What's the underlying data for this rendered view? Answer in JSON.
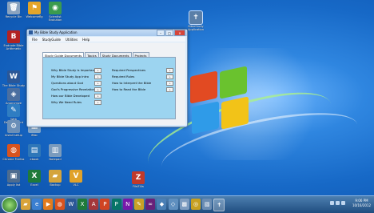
{
  "desktop": {
    "icons": [
      {
        "id": "recycle-bin",
        "label": "Recycle Bin",
        "glyph": "🗑",
        "color": "#8aa3bf"
      },
      {
        "id": "welcomeflag",
        "label": "Welcomeflg",
        "glyph": "⚑",
        "color": "#e3a52a"
      },
      {
        "id": "scientist",
        "label": "Scientist Evolution",
        "glyph": "◉",
        "color": "#3b9b4e"
      },
      {
        "id": "bible-study-app",
        "label": "BibleStudy Application",
        "glyph": "✝",
        "color": "#5a7fa8"
      },
      {
        "id": "endnote",
        "label": "Endnote Bible Arithmetic",
        "glyph": "B",
        "color": "#b22222"
      },
      {
        "id": "word-doc-1",
        "label": "The Bible Study",
        "glyph": "W",
        "color": "#2b5797"
      },
      {
        "id": "app-icon",
        "label": "Anonymize",
        "glyph": "◈",
        "color": "#4b6fa0"
      },
      {
        "id": "tool-icon",
        "label": "Web Development",
        "glyph": "✎",
        "color": "#2f7dc2"
      },
      {
        "id": "setup-icon",
        "label": "install setup",
        "glyph": "⚙",
        "color": "#6a8fb8"
      },
      {
        "id": "chart-icon",
        "label": "iMac",
        "glyph": "▦",
        "color": "#7fa4c9"
      },
      {
        "id": "firefox",
        "label": "Chrome Firefox",
        "glyph": "◍",
        "color": "#d9531e"
      },
      {
        "id": "ebook",
        "label": "ebook",
        "glyph": "▤",
        "color": "#2f77b8"
      },
      {
        "id": "notepad",
        "label": "Notepad",
        "glyph": "▥",
        "color": "#7a9bbd"
      },
      {
        "id": "doc-icon",
        "label": "Apply list",
        "glyph": "▣",
        "color": "#4d6c8f"
      },
      {
        "id": "excel",
        "label": "Excel",
        "glyph": "X",
        "color": "#1f7a3a"
      },
      {
        "id": "folder",
        "label": "Backup",
        "glyph": "▰",
        "color": "#d4a43c"
      },
      {
        "id": "vlc",
        "label": "VLC",
        "glyph": "V",
        "color": "#e0a22a"
      },
      {
        "id": "filezilla",
        "label": "FileZilla",
        "glyph": "Z",
        "color": "#c0392b"
      }
    ]
  },
  "window": {
    "title": "My Bible Study Application",
    "min": "–",
    "max": "□",
    "close": "✕",
    "menu": [
      "File",
      "StudyGuide",
      "Utilities",
      "Help"
    ],
    "tabs": [
      "Study Guide Documents",
      "Topics",
      "Study Documents",
      "Projects"
    ],
    "left_items": [
      "Why Bible Study is Important",
      "My Bible Study App Intro",
      "Questions about God",
      "God's Progressive Revelation",
      "How our Bible Developed",
      "Why We Need Rules"
    ],
    "right_items": [
      "Required Perspectives",
      "Required Rules",
      "How to Interpret the Bible",
      "How to Read the Bible"
    ],
    "go_label": "»"
  },
  "taskbar": {
    "apps": [
      {
        "name": "explorer",
        "glyph": "▰",
        "color": "#d8a33a"
      },
      {
        "name": "ie",
        "glyph": "e",
        "color": "#3a7fd1"
      },
      {
        "name": "media",
        "glyph": "▶",
        "color": "#e27b1d"
      },
      {
        "name": "firefox",
        "glyph": "◍",
        "color": "#d9531e"
      },
      {
        "name": "word",
        "glyph": "W",
        "color": "#2b5797"
      },
      {
        "name": "excel",
        "glyph": "X",
        "color": "#1f7a3a"
      },
      {
        "name": "access",
        "glyph": "A",
        "color": "#a4373a"
      },
      {
        "name": "powerpoint",
        "glyph": "P",
        "color": "#d04423"
      },
      {
        "name": "publisher",
        "glyph": "P",
        "color": "#077568"
      },
      {
        "name": "onenote",
        "glyph": "N",
        "color": "#7719aa"
      },
      {
        "name": "paint",
        "glyph": "✎",
        "color": "#c9a227"
      },
      {
        "name": "vs",
        "glyph": "∞",
        "color": "#68217a"
      },
      {
        "name": "tool1",
        "glyph": "◆",
        "color": "#4a7fb5"
      },
      {
        "name": "tool2",
        "glyph": "◇",
        "color": "#5f8fbf"
      },
      {
        "name": "tool3",
        "glyph": "▩",
        "color": "#7d9cc0"
      },
      {
        "name": "tool4",
        "glyph": "◎",
        "color": "#c7a020"
      },
      {
        "name": "tool5",
        "glyph": "▧",
        "color": "#6b8db3"
      },
      {
        "name": "bible-app",
        "glyph": "✝",
        "color": "#5a7fa8"
      }
    ],
    "time": "9:06 PM",
    "date": "10/16/2012"
  }
}
